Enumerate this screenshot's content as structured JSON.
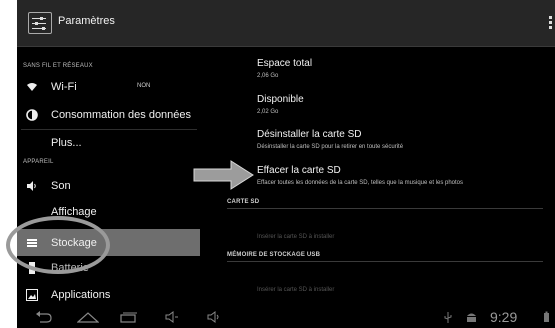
{
  "actionbar": {
    "title": "Paramètres"
  },
  "left": {
    "category_network": "SANS FIL ET RÉSEAUX",
    "wifi_label": "Wi-Fi",
    "wifi_status": "NON",
    "data_usage_label": "Consommation des données",
    "more_label": "Plus...",
    "category_device": "APPAREIL",
    "sound_label": "Son",
    "display_label": "Affichage",
    "storage_label": "Stockage",
    "battery_label": "Batterie",
    "apps_label": "Applications"
  },
  "right": {
    "total_space_title": "Espace total",
    "total_space_value": "2,06 Go",
    "available_title": "Disponible",
    "available_value": "2,02 Go",
    "unmount_title": "Désinstaller la carte SD",
    "unmount_sub": "Désinstaller la carte SD pour la retirer en toute sécurité",
    "erase_title": "Effacer la carte SD",
    "erase_sub": "Effacer toutes les données de la carte SD, telles que la musique et les photos",
    "section_sd": "CARTE SD",
    "insert_sd": "Insérer la carte SD à installer",
    "section_usb": "MÉMOIRE DE STOCKAGE USB",
    "insert_usb": "Insérer la carte SD à installer"
  },
  "navbar": {
    "clock": "9:29"
  },
  "icons": {
    "app": "settings-sliders-icon",
    "wifi": "wifi-icon",
    "data": "data-usage-icon",
    "sound": "speaker-icon",
    "storage": "storage-icon",
    "battery": "battery-icon",
    "apps": "apps-icon"
  }
}
